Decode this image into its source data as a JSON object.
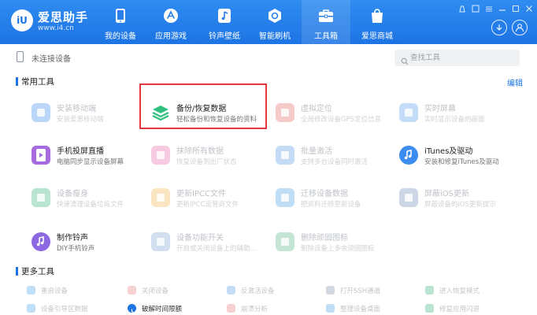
{
  "app": {
    "name": "爱思助手",
    "url": "www.i4.cn",
    "logo_text": "iU"
  },
  "nav": [
    {
      "label": "我的设备",
      "icon": "phone-icon",
      "active": false
    },
    {
      "label": "应用游戏",
      "icon": "apps-icon",
      "active": false
    },
    {
      "label": "铃声壁纸",
      "icon": "ringtone-icon",
      "active": false
    },
    {
      "label": "智能刷机",
      "icon": "flash-icon",
      "active": false
    },
    {
      "label": "工具箱",
      "icon": "toolbox-icon",
      "active": true
    },
    {
      "label": "爱思商城",
      "icon": "store-icon",
      "active": false
    }
  ],
  "device": {
    "status": "未连接设备"
  },
  "search": {
    "placeholder": "查找工具"
  },
  "sections": {
    "common": "常用工具",
    "more": "更多工具",
    "edit": "编辑"
  },
  "tools": [
    {
      "name": "安装移动端",
      "desc": "安装爱思移动端",
      "icon": "i4-mobile-icon",
      "color": "#3b8ef0",
      "faded": true
    },
    {
      "name": "备份/恢复数据",
      "desc": "轻松备份和恢复设备的资料",
      "icon": "layers-icon",
      "color": "#2fbf7e",
      "faded": false
    },
    {
      "name": "虚拟定位",
      "desc": "全局修改设备GPS定位信息",
      "icon": "location-icon",
      "color": "#e96b6b",
      "faded": true
    },
    {
      "name": "实时屏幕",
      "desc": "实时显示设备的画面",
      "icon": "screen-icon",
      "color": "#5b9cf0",
      "faded": true
    },
    {
      "name": "手机投屏直播",
      "desc": "电脑同步显示设备屏幕",
      "icon": "cast-icon",
      "color": "#a66ae0",
      "faded": false
    },
    {
      "name": "抹除所有数据",
      "desc": "恢复设备到出厂状态",
      "icon": "erase-icon",
      "color": "#e86aa8",
      "faded": true
    },
    {
      "name": "批量激活",
      "desc": "支持多台设备同时激活",
      "icon": "activate-icon",
      "color": "#5a9ae8",
      "faded": true
    },
    {
      "name": "iTunes及驱动",
      "desc": "安装和修复iTunes及驱动",
      "icon": "music-icon",
      "color": "#3b8ef0",
      "faded": false
    },
    {
      "name": "设备瘦身",
      "desc": "快速清理设备垃圾文件",
      "icon": "clean-icon",
      "color": "#36b37e",
      "faded": true
    },
    {
      "name": "更新IPCC文件",
      "desc": "更新IPCC运营商文件",
      "icon": "ipcc-icon",
      "color": "#f2b450",
      "faded": true
    },
    {
      "name": "迁移设备数据",
      "desc": "把资料迁移至新设备",
      "icon": "migrate-icon",
      "color": "#4aa3e8",
      "faded": true
    },
    {
      "name": "屏蔽iOS更新",
      "desc": "屏蔽设备的iOS更新提示",
      "icon": "block-update-icon",
      "color": "#6f8fb8",
      "faded": true
    },
    {
      "name": "制作铃声",
      "desc": "DIY手机铃声",
      "icon": "ringtone-maker-icon",
      "color": "#8e68e0",
      "faded": false
    },
    {
      "name": "设备功能开关",
      "desc": "开启或关闭设备上的辅助...",
      "icon": "switch-icon",
      "color": "#7aa2d6",
      "faded": true
    },
    {
      "name": "删除顽固图标",
      "desc": "删除设备上多余顽固图标",
      "icon": "delete-icon",
      "color": "#5db88a",
      "faded": true
    }
  ],
  "more_tools": [
    {
      "name": "重启设备",
      "icon": "restart-icon",
      "color": "#4aa3e8",
      "enabled": false
    },
    {
      "name": "关闭设备",
      "icon": "power-icon",
      "color": "#e87a7a",
      "enabled": false
    },
    {
      "name": "反激活设备",
      "icon": "deactivate-icon",
      "color": "#5a9ae8",
      "enabled": false
    },
    {
      "name": "打开SSH通道",
      "icon": "ssh-icon",
      "color": "#7a8ea8",
      "enabled": false
    },
    {
      "name": "进入恢复模式",
      "icon": "recovery-icon",
      "color": "#36b37e",
      "enabled": false
    },
    {
      "name": "设备引导区数据",
      "icon": "boot-data-icon",
      "color": "#4aa3e8",
      "enabled": false
    },
    {
      "name": "破解时间限额",
      "icon": "clock-icon",
      "color": "#1d74e4",
      "enabled": true
    },
    {
      "name": "崩溃分析",
      "icon": "crash-icon",
      "color": "#e87a7a",
      "enabled": false
    },
    {
      "name": "整理设备桌面",
      "icon": "desktop-icon",
      "color": "#4aa3e8",
      "enabled": false
    },
    {
      "name": "修复应用闪退",
      "icon": "repair-icon",
      "color": "#36b37e",
      "enabled": false
    }
  ],
  "colors": {
    "accent": "#1d74e4",
    "highlight": "#e0383c"
  }
}
